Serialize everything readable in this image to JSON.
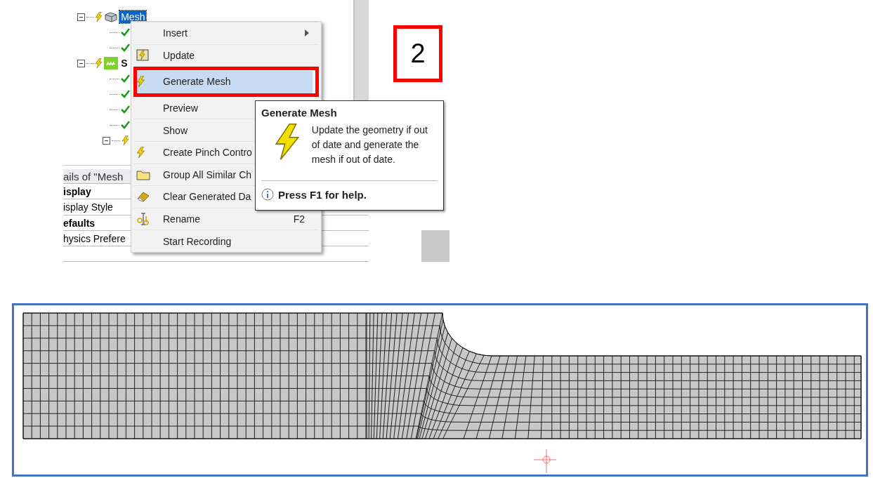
{
  "tree": {
    "items": [
      {
        "label": "Mesh",
        "done": false,
        "selected": true,
        "bold": false,
        "children": [
          {
            "kind": "leaf",
            "done": true
          },
          {
            "kind": "leaf",
            "done": true
          }
        ]
      },
      {
        "label": "S",
        "done": false,
        "selected": false,
        "bold": true,
        "children": [
          {
            "kind": "leaf",
            "done": true
          },
          {
            "kind": "leaf",
            "done": true
          },
          {
            "kind": "leaf",
            "done": true
          },
          {
            "kind": "leaf",
            "done": true
          },
          {
            "kind": "group",
            "done": false
          }
        ]
      }
    ]
  },
  "details": {
    "title": "ails of \"Mesh",
    "rows": [
      {
        "kind": "group",
        "label": "isplay"
      },
      {
        "kind": "field",
        "label": "isplay Style"
      },
      {
        "kind": "group",
        "label": "efaults"
      },
      {
        "kind": "field",
        "label": "hysics Prefere"
      }
    ]
  },
  "menu": {
    "items": [
      {
        "label": "Insert",
        "kind": "plain",
        "submenu": true,
        "selected": false,
        "outlined": false
      },
      {
        "label": "Update",
        "kind": "update",
        "submenu": false,
        "selected": false,
        "outlined": false
      },
      {
        "label": "Generate Mesh",
        "kind": "bolt",
        "submenu": false,
        "selected": true,
        "outlined": true
      },
      {
        "label": "Preview",
        "kind": "plain",
        "submenu": false,
        "selected": false,
        "outlined": false
      },
      {
        "label": "Show",
        "kind": "plain",
        "submenu": false,
        "selected": false,
        "outlined": false
      },
      {
        "label": "Create Pinch Contro",
        "kind": "bolt",
        "submenu": false,
        "selected": false,
        "outlined": false
      },
      {
        "label": "Group All Similar Ch",
        "kind": "folder",
        "submenu": false,
        "selected": false,
        "outlined": false
      },
      {
        "label": "Clear Generated Da",
        "kind": "eraser",
        "submenu": false,
        "selected": false,
        "outlined": false
      },
      {
        "label": "Rename",
        "kind": "rename",
        "shortcut": "F2",
        "submenu": false,
        "selected": false,
        "outlined": false
      },
      {
        "label": "Start Recording",
        "kind": "plain",
        "submenu": false,
        "selected": false,
        "outlined": false
      }
    ]
  },
  "tooltip": {
    "title": "Generate Mesh",
    "description": "Update the geometry if out of date and generate the mesh if out of date.",
    "help": "Press F1 for help."
  },
  "step": {
    "label": "2"
  }
}
